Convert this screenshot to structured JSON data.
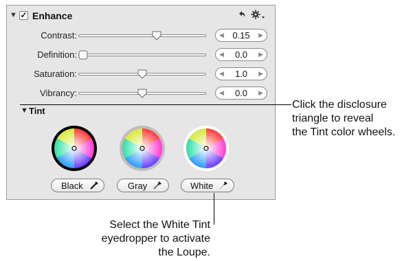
{
  "enhance": {
    "title": "Enhance",
    "checked": true,
    "checkmark": "✓",
    "disclosure_glyph": "▼",
    "undo_icon": "undo-arrow",
    "gear_icon": "gear-menu"
  },
  "sliders": [
    {
      "label": "Contrast:",
      "value": "0.15",
      "level": 0.62
    },
    {
      "label": "Definition:",
      "value": "0.0",
      "level": 0.0
    },
    {
      "label": "Saturation:",
      "value": "1.0",
      "level": 0.5
    },
    {
      "label": "Vibrancy:",
      "value": "0.0",
      "level": 0.5
    }
  ],
  "stepper": {
    "left_arrow": "◀",
    "right_arrow": "▶"
  },
  "tint": {
    "title": "Tint",
    "disclosure_glyph": "▼",
    "buttons": {
      "black": "Black",
      "gray": "Gray",
      "white": "White"
    }
  },
  "callouts": {
    "disclosure_lines": [
      "Click the disclosure",
      "triangle to reveal",
      "the Tint color wheels."
    ],
    "eyedropper_lines": [
      "Select the White Tint",
      "eyedropper to activate",
      "the Loupe."
    ]
  },
  "colors": {
    "panel_bg": "#e6e6e6",
    "panel_border": "#9a9a9a",
    "text": "#111111"
  }
}
